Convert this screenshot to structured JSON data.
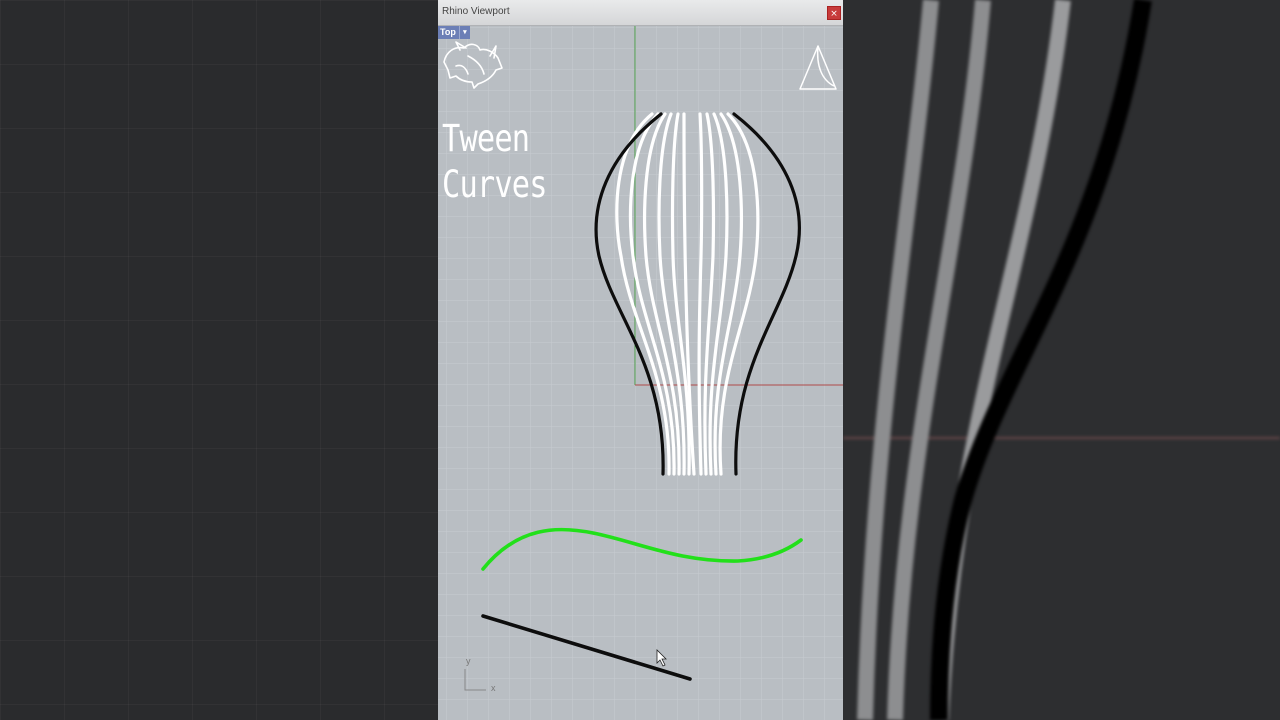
{
  "window": {
    "title": "Rhino Viewport",
    "close_label": "×",
    "viewport_name": "Top",
    "viewport_menu_arrow": "▾"
  },
  "overlay": {
    "line1": "Tween",
    "line2": "Curves"
  },
  "axes": {
    "x": "x",
    "y": "y"
  },
  "icons": {
    "logo_left": "rhino-logo-icon",
    "logo_right": "brand-a-logo-icon",
    "cursor": "mouse-pointer-icon"
  },
  "colors": {
    "viewport_bg": "#b9bec3",
    "grid": "#c8ccd0",
    "x_axis": "#b04a4a",
    "y_axis": "#4a9a4a",
    "curve_selected": "#22e01a",
    "curve_black": "#111111",
    "tween_curves": "#ffffff",
    "tab_bg": "#6c7fb6",
    "close_button": "#c73b3b"
  }
}
